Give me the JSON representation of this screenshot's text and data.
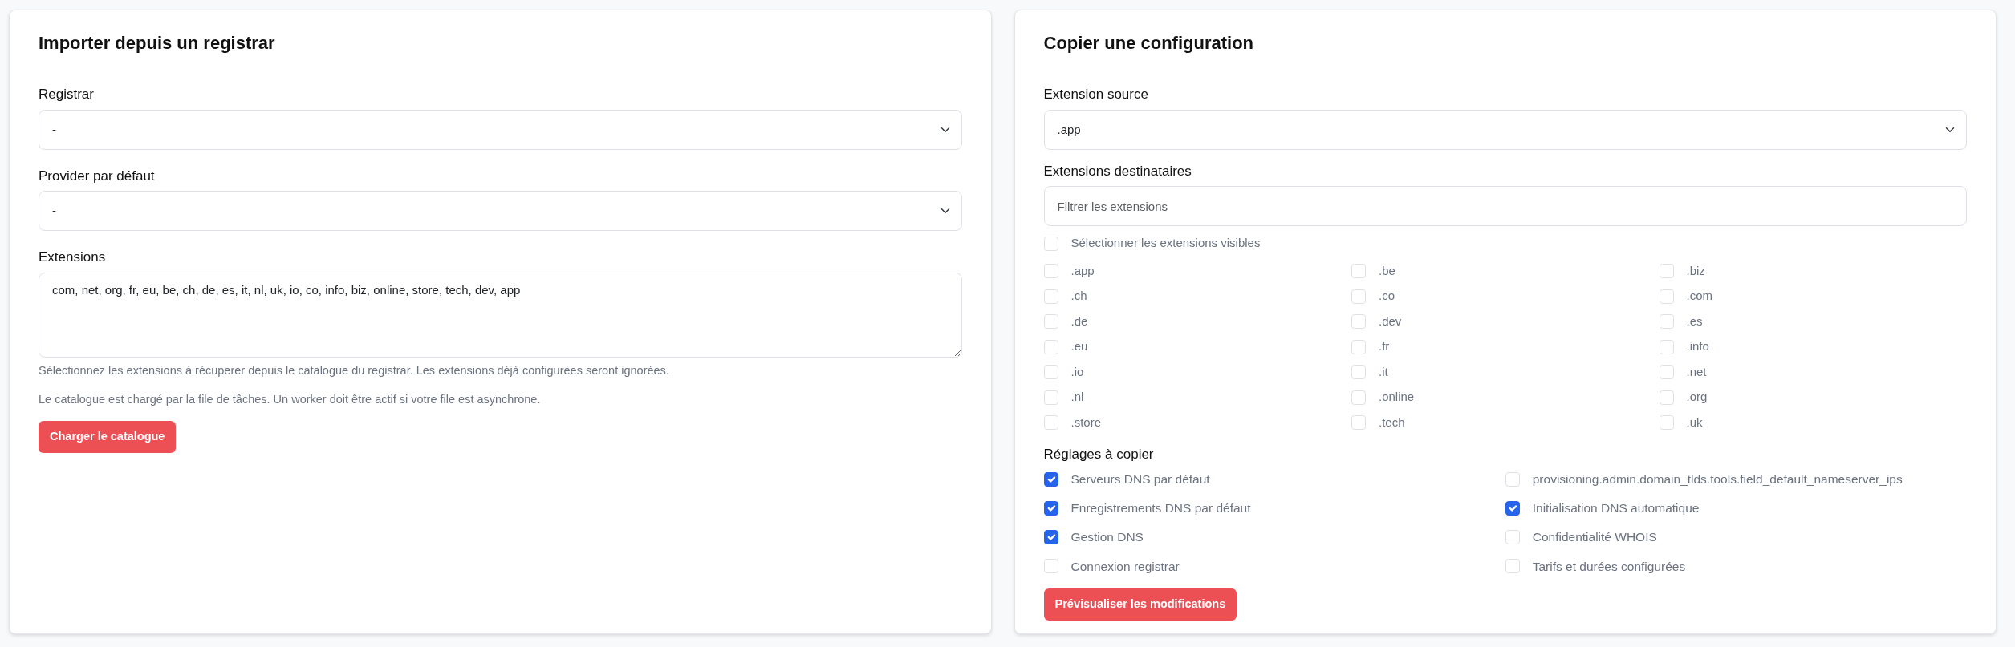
{
  "import_panel": {
    "title": "Importer depuis un registrar",
    "fields": [
      {
        "kind": "select",
        "label": "Registrar",
        "value": "-"
      },
      {
        "kind": "select",
        "label": "Provider par défaut",
        "value": "-"
      },
      {
        "kind": "textarea",
        "label": "Extensions",
        "value": "com, net, org, fr, eu, be, ch, de, es, it, nl, uk, io, co, info, biz, online, store, tech, dev, app"
      }
    ],
    "help_texts": [
      "Sélectionnez les extensions à récuperer depuis le catalogue du registrar. Les extensions déjà configurées seront ignorées.",
      "Le catalogue est chargé par la file de tâches. Un worker doit être actif si votre file est asynchrone."
    ],
    "button": "Charger le catalogue"
  },
  "copy_panel": {
    "title": "Copier une configuration",
    "source": {
      "label": "Extension source",
      "value": ".app"
    },
    "targets": {
      "label": "Extensions destinataires",
      "filter_placeholder": "Filtrer les extensions",
      "select_visible": {
        "label": "Sélectionner les extensions visibles",
        "checked": false
      },
      "extensions": [
        {
          "label": ".app",
          "checked": false
        },
        {
          "label": ".be",
          "checked": false
        },
        {
          "label": ".biz",
          "checked": false
        },
        {
          "label": ".ch",
          "checked": false
        },
        {
          "label": ".co",
          "checked": false
        },
        {
          "label": ".com",
          "checked": false
        },
        {
          "label": ".de",
          "checked": false
        },
        {
          "label": ".dev",
          "checked": false
        },
        {
          "label": ".es",
          "checked": false
        },
        {
          "label": ".eu",
          "checked": false
        },
        {
          "label": ".fr",
          "checked": false
        },
        {
          "label": ".info",
          "checked": false
        },
        {
          "label": ".io",
          "checked": false
        },
        {
          "label": ".it",
          "checked": false
        },
        {
          "label": ".net",
          "checked": false
        },
        {
          "label": ".nl",
          "checked": false
        },
        {
          "label": ".online",
          "checked": false
        },
        {
          "label": ".org",
          "checked": false
        },
        {
          "label": ".store",
          "checked": false
        },
        {
          "label": ".tech",
          "checked": false
        },
        {
          "label": ".uk",
          "checked": false
        }
      ]
    },
    "settings": {
      "label": "Réglages à copier",
      "items": [
        {
          "label": "Serveurs DNS par défaut",
          "checked": true
        },
        {
          "label": "provisioning.admin.domain_tlds.tools.field_default_nameserver_ips",
          "checked": false
        },
        {
          "label": "Enregistrements DNS par défaut",
          "checked": true
        },
        {
          "label": "Initialisation DNS automatique",
          "checked": true
        },
        {
          "label": "Gestion DNS",
          "checked": true
        },
        {
          "label": "Confidentialité WHOIS",
          "checked": false
        },
        {
          "label": "Connexion registrar",
          "checked": false
        },
        {
          "label": "Tarifs et durées configurées",
          "checked": false
        }
      ]
    },
    "button": "Prévisualiser les modifications"
  }
}
